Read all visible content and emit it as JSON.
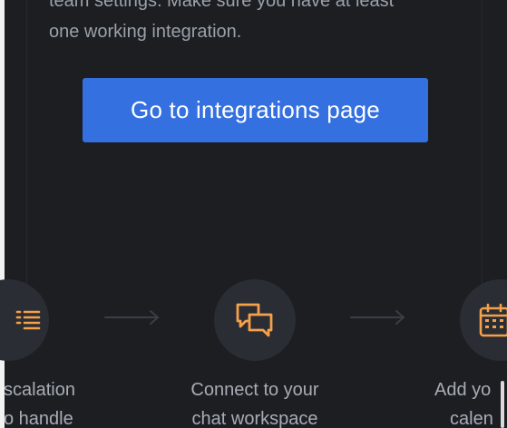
{
  "onboarding": {
    "description_lines": [
      "team settings. Make sure you have at least",
      "one working integration."
    ],
    "cta_label": "Go to integrations page"
  },
  "steps": [
    {
      "icon": "list-icon",
      "label_lines": [
        "scalation",
        "o handle"
      ]
    },
    {
      "icon": "chat-bubbles-icon",
      "label_lines": [
        "Connect to your",
        "chat workspace"
      ]
    },
    {
      "icon": "calendar-icon",
      "label_lines": [
        "Add yo",
        "calen"
      ]
    }
  ],
  "colors": {
    "background": "#1c1e22",
    "primary_button": "#3470e0",
    "icon_accent": "#f5a04a",
    "icon_circle": "#2a2d33",
    "muted_text": "#9ba1aa"
  }
}
